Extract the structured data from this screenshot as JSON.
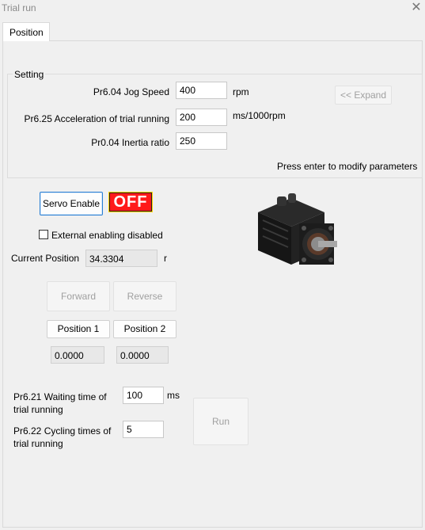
{
  "window": {
    "title": "Trial run"
  },
  "tabs": [
    {
      "label": "Position"
    }
  ],
  "setting": {
    "group_title": "Setting",
    "jog_speed": {
      "label": "Pr6.04 Jog Speed",
      "value": "400",
      "unit": "rpm"
    },
    "acceleration": {
      "label": "Pr6.25 Acceleration of trial running",
      "value": "200",
      "unit": "ms/1000rpm"
    },
    "inertia": {
      "label": "Pr0.04 Inertia ratio",
      "value": "250"
    },
    "expand_label": "<< Expand",
    "hint": "Press enter to modify parameters"
  },
  "servo": {
    "enable_label": "Servo Enable",
    "state": "OFF",
    "state_color": "#ff1a1a",
    "external_label": "External enabling disabled",
    "external_checked": false
  },
  "position": {
    "label": "Current Position",
    "value": "34.3304",
    "unit": "r"
  },
  "motion": {
    "forward_label": "Forward",
    "reverse_label": "Reverse",
    "pos1_label": "Position 1",
    "pos2_label": "Position 2",
    "pos1_value": "0.0000",
    "pos2_value": "0.0000"
  },
  "cycle": {
    "wait_label_line1": "Pr6.21 Waiting time of",
    "wait_label_line2": "trial running",
    "wait_value": "100",
    "wait_unit": "ms",
    "cycle_label_line1": "Pr6.22 Cycling times of",
    "cycle_label_line2": "trial running",
    "cycle_value": "5",
    "run_label": "Run"
  },
  "icons": {
    "close": "close-icon",
    "motor": "servo-motor-image"
  }
}
